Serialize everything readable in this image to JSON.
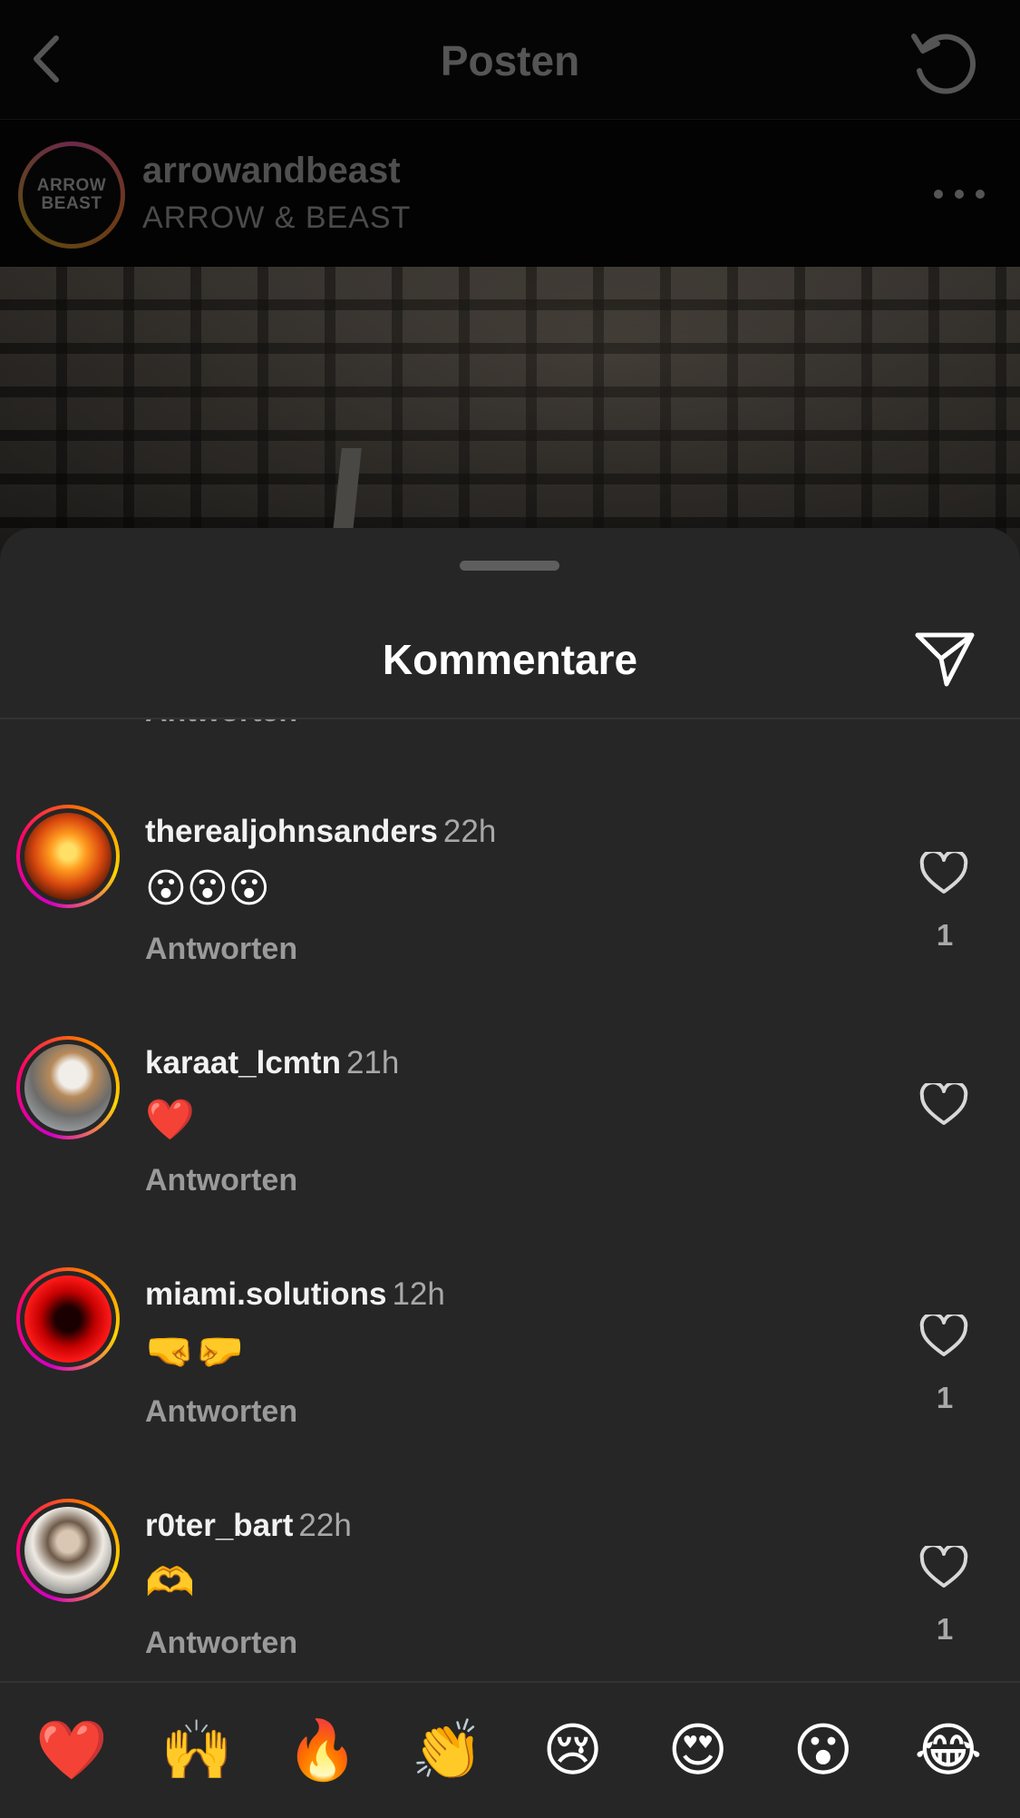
{
  "header": {
    "title": "Posten",
    "back_icon": "chevron-left-icon",
    "reload_icon": "reload-icon"
  },
  "post": {
    "username": "arrowandbeast",
    "full_name": "ARROW & BEAST",
    "avatar_line1": "ARROW",
    "avatar_line2": "BEAST",
    "more_icon": "more-horizontal-icon"
  },
  "sheet": {
    "title": "Kommentare",
    "share_icon": "send-icon",
    "cut_reply_label": "Antworten"
  },
  "comments": [
    {
      "username": "therealjohnsanders",
      "time": "22h",
      "text": "😮😮😮",
      "reply_label": "Antworten",
      "likes": "1",
      "avatar": "fire-skeleton-avatar"
    },
    {
      "username": "karaat_lcmtn",
      "time": "21h",
      "text": "❤️",
      "reply_label": "Antworten",
      "likes": "",
      "avatar": "dog-avatar"
    },
    {
      "username": "miami.solutions",
      "time": "12h",
      "text": "🤜🤛",
      "reply_label": "Antworten",
      "likes": "1",
      "avatar": "red-portrait-avatar"
    },
    {
      "username": "r0ter_bart",
      "time": "22h",
      "text": "🫶",
      "reply_label": "Antworten",
      "likes": "1",
      "avatar": "man-portrait-avatar"
    }
  ],
  "emoji_bar": [
    "❤️",
    "🙌",
    "🔥",
    "👏",
    "😢",
    "😍",
    "😮",
    "😂"
  ],
  "colors": {
    "sheet_bg": "#262626",
    "secondary_text": "#a8a8a8",
    "story_ring": [
      "#d300c5",
      "#ff0069",
      "#ff7a00",
      "#ffd600"
    ]
  }
}
